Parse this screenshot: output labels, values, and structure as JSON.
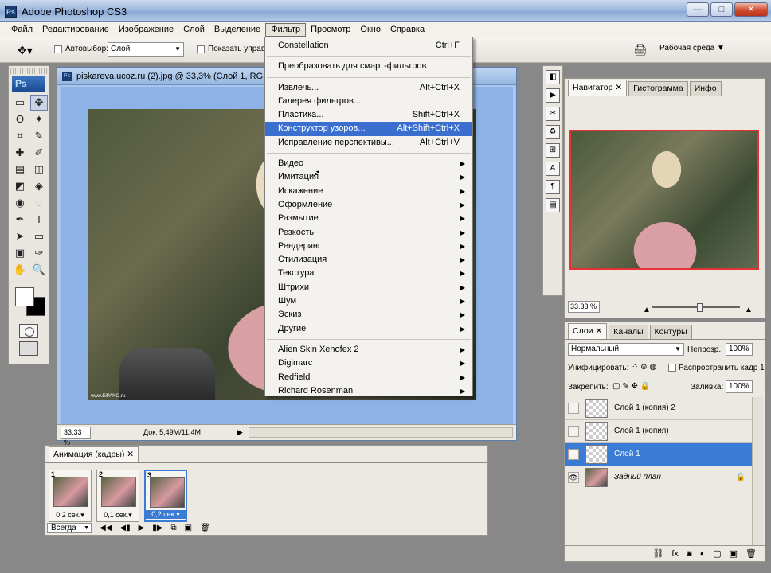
{
  "app": {
    "title": "Adobe Photoshop CS3",
    "logo": "Ps",
    "window_buttons": [
      "—",
      "□",
      "✕"
    ]
  },
  "menubar": {
    "items": [
      "Файл",
      "Редактирование",
      "Изображение",
      "Слой",
      "Выделение",
      "Фильтр",
      "Просмотр",
      "Окно",
      "Справка"
    ],
    "active": "Фильтр"
  },
  "options": {
    "autoselect_label": "Автовыбор:",
    "autoselect_value": "Слой",
    "show_controls_label": "Показать управ",
    "workspace_label": "Рабочая среда ▼"
  },
  "toolbox": {
    "logo": "Ps",
    "tools": [
      "▭",
      "✥",
      "ʘ",
      "✦",
      "⌗",
      "✎",
      "✚",
      "✐",
      "▤",
      "◫",
      "◩",
      "◈",
      "◉",
      "◌",
      "✒",
      "T",
      "➤",
      "▭",
      "▣",
      "✑",
      "✋",
      "🔍"
    ]
  },
  "document": {
    "title": "piskareva.ucoz.ru (2).jpg @ 33,3% (Слой 1, RGB/8",
    "icon": "Ps",
    "zoom": "33,33 %",
    "info": "Док: 5,49M/11,4M",
    "watermark": "www.ElPANO.ru"
  },
  "filter_menu": {
    "groups": [
      [
        {
          "label": "Constellation",
          "shortcut": "Ctrl+F"
        }
      ],
      [
        {
          "label": "Преобразовать для смарт-фильтров"
        }
      ],
      [
        {
          "label": "Извлечь...",
          "shortcut": "Alt+Ctrl+X"
        },
        {
          "label": "Галерея фильтров..."
        },
        {
          "label": "Пластика...",
          "shortcut": "Shift+Ctrl+X"
        },
        {
          "label": "Конструктор узоров...",
          "shortcut": "Alt+Shift+Ctrl+X",
          "highlighted": true
        },
        {
          "label": "Исправление перспективы...",
          "shortcut": "Alt+Ctrl+V"
        }
      ],
      [
        {
          "label": "Видео",
          "submenu": true
        },
        {
          "label": "Имитация",
          "submenu": true
        },
        {
          "label": "Искажение",
          "submenu": true
        },
        {
          "label": "Оформление",
          "submenu": true
        },
        {
          "label": "Размытие",
          "submenu": true
        },
        {
          "label": "Резкость",
          "submenu": true
        },
        {
          "label": "Рендеринг",
          "submenu": true
        },
        {
          "label": "Стилизация",
          "submenu": true
        },
        {
          "label": "Текстура",
          "submenu": true
        },
        {
          "label": "Штрихи",
          "submenu": true
        },
        {
          "label": "Шум",
          "submenu": true
        },
        {
          "label": "Эскиз",
          "submenu": true
        },
        {
          "label": "Другие",
          "submenu": true
        }
      ],
      [
        {
          "label": "Alien Skin Xenofex 2",
          "submenu": true
        },
        {
          "label": "Digimarc",
          "submenu": true
        },
        {
          "label": "Redfield",
          "submenu": true
        },
        {
          "label": "Richard Rosenman",
          "submenu": true
        }
      ]
    ]
  },
  "rightstrip": {
    "buttons": [
      "◧",
      "▶",
      "✂",
      "♻",
      "⊞",
      "A",
      "¶",
      "▤"
    ]
  },
  "navigator": {
    "tabs": [
      "Навигатор ✕",
      "Гистограмма",
      "Инфо"
    ],
    "zoom": "33.33 %"
  },
  "layers": {
    "tabs": [
      "Слои ✕",
      "Каналы",
      "Контуры"
    ],
    "blend_mode": "Нормальный",
    "opacity_label": "Непрозр.:",
    "opacity_value": "100%",
    "unify_label": "Унифицировать:",
    "propagate_label": "Распространить кадр 1",
    "lock_label": "Закрепить:",
    "fill_label": "Заливка:",
    "fill_value": "100%",
    "items": [
      {
        "name": "Слой 1 (копия) 2",
        "visible": false,
        "thumb": "transparent"
      },
      {
        "name": "Слой 1 (копия)",
        "visible": false,
        "thumb": "transparent"
      },
      {
        "name": "Слой 1",
        "visible": true,
        "thumb": "transparent",
        "selected": true
      },
      {
        "name": "Задний план",
        "visible": true,
        "thumb": "image",
        "locked": true
      }
    ],
    "bottom_icons": [
      "⛓",
      "fx",
      "◙",
      "◐",
      "▢",
      "▣",
      "🗑"
    ]
  },
  "animation": {
    "tab": "Анимация (кадры) ✕",
    "frames": [
      {
        "num": "1",
        "delay": "0,2 сек.▾"
      },
      {
        "num": "2",
        "delay": "0,1 сек.▾"
      },
      {
        "num": "3",
        "delay": "0,2 сек.▾",
        "selected": true
      }
    ],
    "loop": "Всегда",
    "controls": [
      "◀◀",
      "◀▮",
      "▶",
      "▮▶",
      "⧉",
      "▣",
      "🗑"
    ]
  }
}
